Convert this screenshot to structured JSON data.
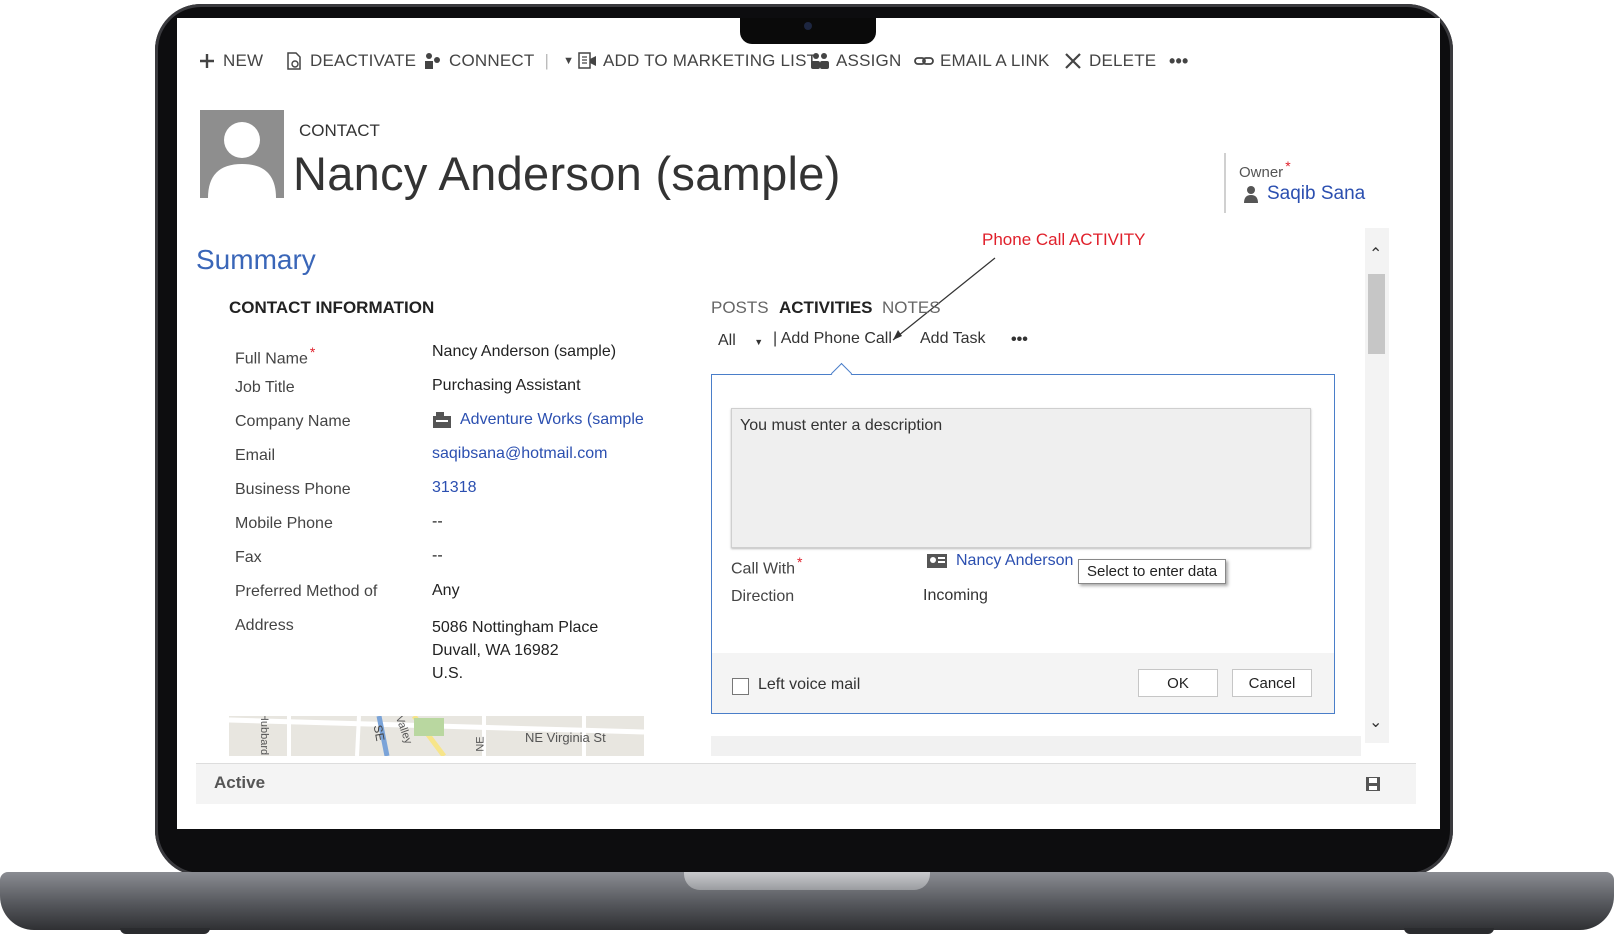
{
  "command_bar": {
    "new": "NEW",
    "deactivate": "DEACTIVATE",
    "connect": "CONNECT",
    "add_to_marketing_list": "ADD TO MARKETING LIST",
    "assign": "ASSIGN",
    "email_a_link": "EMAIL A LINK",
    "delete": "DELETE",
    "more": "•••"
  },
  "header": {
    "entity_type": "CONTACT",
    "record_name": "Nancy Anderson (sample)",
    "owner_label": "Owner",
    "owner_value": "Saqib Sana"
  },
  "annotation": {
    "text": "Phone Call ACTIVITY",
    "color": "#e0202b"
  },
  "summary": {
    "title": "Summary",
    "section_title": "CONTACT INFORMATION",
    "fields": {
      "full_name_label": "Full Name",
      "full_name_value": "Nancy Anderson (sample)",
      "job_title_label": "Job Title",
      "job_title_value": "Purchasing Assistant",
      "company_label": "Company Name",
      "company_value": "Adventure Works (sample",
      "email_label": "Email",
      "email_value": "saqibsana@hotmail.com",
      "business_phone_label": "Business Phone",
      "business_phone_value": "31318",
      "mobile_phone_label": "Mobile Phone",
      "mobile_phone_value": "--",
      "fax_label": "Fax",
      "fax_value": "--",
      "preferred_label": "Preferred Method of",
      "preferred_value": "Any",
      "address_label": "Address",
      "address_line1": "5086 Nottingham Place",
      "address_line2": "Duvall, WA 16982",
      "address_line3": "U.S."
    },
    "map": {
      "street": "NE Virginia St",
      "street2": "SE",
      "street3": "Valley",
      "street4": "NE",
      "street5": "Hubbard"
    }
  },
  "activity_panel": {
    "tabs": [
      "POSTS",
      "ACTIVITIES",
      "NOTES"
    ],
    "filter": "All",
    "add_phone_call": "| Add Phone Call",
    "add_task": "Add Task",
    "more": "•••",
    "description_placeholder": "You must enter a description",
    "call_with_label": "Call With",
    "call_with_value": "Nancy Anderson",
    "tooltip": "Select to enter data",
    "direction_label": "Direction",
    "direction_value": "Incoming",
    "left_voice_mail": "Left voice mail",
    "ok": "OK",
    "cancel": "Cancel"
  },
  "footer": {
    "status": "Active"
  },
  "colors": {
    "link": "#2b4fb0",
    "summary_title": "#3a66b8",
    "required": "#e0202b",
    "panel_border": "#4a7ec9"
  }
}
